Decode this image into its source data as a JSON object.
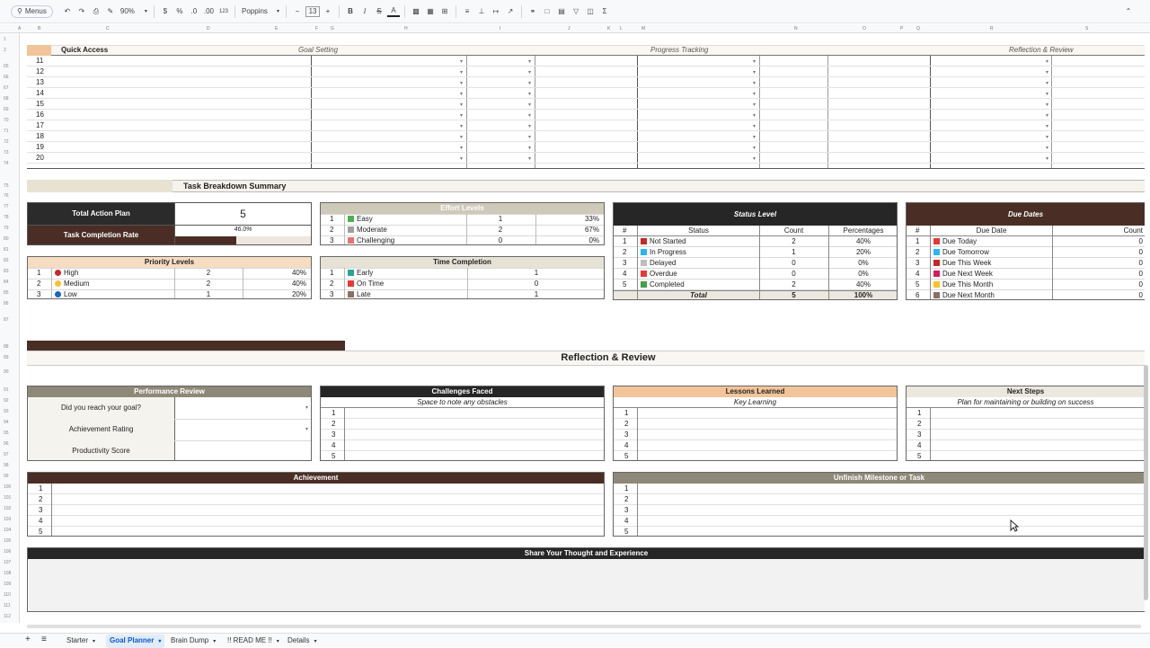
{
  "toolbar": {
    "menus_label": "Menus",
    "zoom": "90%",
    "currency": "$",
    "percent": "%",
    "dec_decrease": ".0",
    "dec_increase": ".00",
    "number_format": "123",
    "font": "Poppins",
    "font_size": "13",
    "bold": "B",
    "italic": "I",
    "text_color": "A",
    "sigma": "Σ"
  },
  "columns": [
    "A",
    "B",
    "C",
    "D",
    "E",
    "F",
    "G",
    "H",
    "I",
    "J",
    "K",
    "L",
    "M",
    "N",
    "O",
    "P",
    "Q",
    "R",
    "S"
  ],
  "top_header": {
    "quick_access": "Quick Access",
    "goal_setting": "Goal Setting",
    "progress_tracking": "Progress Tracking",
    "reflection_review": "Reflection & Review"
  },
  "tracker_rows": [
    "11",
    "12",
    "13",
    "14",
    "15",
    "16",
    "17",
    "18",
    "19",
    "20"
  ],
  "task_breakdown": {
    "title": "Task Breakdown Summary",
    "total_action_plan_label": "Total Action Plan",
    "total_action_plan_value": "5",
    "completion_rate_label": "Task Completion Rate",
    "completion_rate_value": "46.0%",
    "completion_rate_fraction": 0.46
  },
  "effort_levels": {
    "title": "Effort Levels",
    "rows": [
      {
        "n": "1",
        "label": "Easy",
        "count": "1",
        "pct": "33%",
        "icon": "check-icon",
        "color": "#4caf50"
      },
      {
        "n": "2",
        "label": "Moderate",
        "count": "2",
        "pct": "67%",
        "icon": "gear-icon",
        "color": "#9e9e9e"
      },
      {
        "n": "3",
        "label": "Challenging",
        "count": "0",
        "pct": "0%",
        "icon": "rocket-icon",
        "color": "#e57373"
      }
    ]
  },
  "priority_levels": {
    "title": "Priority Levels",
    "rows": [
      {
        "n": "1",
        "label": "High",
        "count": "2",
        "pct": "40%",
        "color": "#c62828"
      },
      {
        "n": "2",
        "label": "Medium",
        "count": "2",
        "pct": "40%",
        "color": "#fbc02d"
      },
      {
        "n": "3",
        "label": "Low",
        "count": "1",
        "pct": "20%",
        "color": "#1565c0"
      }
    ]
  },
  "time_completion": {
    "title": "Time Completion",
    "rows": [
      {
        "n": "1",
        "label": "Early",
        "count": "1",
        "icon": "calendar-check-icon",
        "color": "#26a69a"
      },
      {
        "n": "2",
        "label": "On Time",
        "count": "0",
        "icon": "target-icon",
        "color": "#e53935"
      },
      {
        "n": "3",
        "label": "Late",
        "count": "1",
        "icon": "hourglass-icon",
        "color": "#8d6e63"
      }
    ]
  },
  "status_level": {
    "title": "Status Level",
    "col_n": "#",
    "col_status": "Status",
    "col_count": "Count",
    "col_pct": "Percentages",
    "rows": [
      {
        "n": "1",
        "label": "Not Started",
        "count": "2",
        "pct": "40%",
        "icon": "cross-icon",
        "color": "#c62828"
      },
      {
        "n": "2",
        "label": "In Progress",
        "count": "1",
        "pct": "20%",
        "icon": "progress-icon",
        "color": "#29b6f6"
      },
      {
        "n": "3",
        "label": "Delayed",
        "count": "0",
        "pct": "0%",
        "icon": "hourglass-icon",
        "color": "#bdbdbd"
      },
      {
        "n": "4",
        "label": "Overdue",
        "count": "0",
        "pct": "0%",
        "icon": "warning-icon",
        "color": "#e53935"
      },
      {
        "n": "5",
        "label": "Completed",
        "count": "2",
        "pct": "40%",
        "icon": "check-box-icon",
        "color": "#43a047"
      }
    ],
    "total_label": "Total",
    "total_count": "5",
    "total_pct": "100%"
  },
  "due_dates": {
    "title": "Due Dates",
    "col_n": "#",
    "col_due": "Due Date",
    "col_count": "Count",
    "rows": [
      {
        "n": "1",
        "label": "Due Today",
        "count": "0",
        "icon": "calendar-icon",
        "color": "#e53935"
      },
      {
        "n": "2",
        "label": "Due Tomorrow",
        "count": "0",
        "icon": "calendar-icon",
        "color": "#29b6f6"
      },
      {
        "n": "3",
        "label": "Due This Week",
        "count": "0",
        "icon": "pin-icon",
        "color": "#c62828"
      },
      {
        "n": "4",
        "label": "Due Next Week",
        "count": "0",
        "icon": "pushpin-icon",
        "color": "#d81b60"
      },
      {
        "n": "5",
        "label": "Due This Month",
        "count": "0",
        "icon": "pencil-icon",
        "color": "#fbc02d"
      },
      {
        "n": "6",
        "label": "Due Next Month",
        "count": "0",
        "icon": "calendar-icon",
        "color": "#8d6e63"
      }
    ]
  },
  "reflection": {
    "title": "Reflection & Review",
    "performance": {
      "title": "Performance Review",
      "q1": "Did you reach your goal?",
      "q2": "Achievement Rating",
      "q3": "Productivity Score"
    },
    "challenges": {
      "title": "Challenges Faced",
      "subtitle": "Space to note any obstacles"
    },
    "lessons": {
      "title": "Lessons Learned",
      "subtitle": "Key Learning"
    },
    "next_steps": {
      "title": "Next Steps",
      "subtitle": "Plan for maintaining or building on success"
    },
    "numbers": [
      "1",
      "2",
      "3",
      "4",
      "5"
    ],
    "achievement": {
      "title": "Achievement"
    },
    "unfinished": {
      "title": "Unfinish Milestone or Task"
    },
    "share": {
      "title": "Share Your Thought and Experience"
    }
  },
  "sheet_tabs": [
    "Starter",
    "Goal Planner",
    "Brain Dump",
    "!! READ ME !!",
    "Details"
  ],
  "active_tab": "Goal Planner"
}
